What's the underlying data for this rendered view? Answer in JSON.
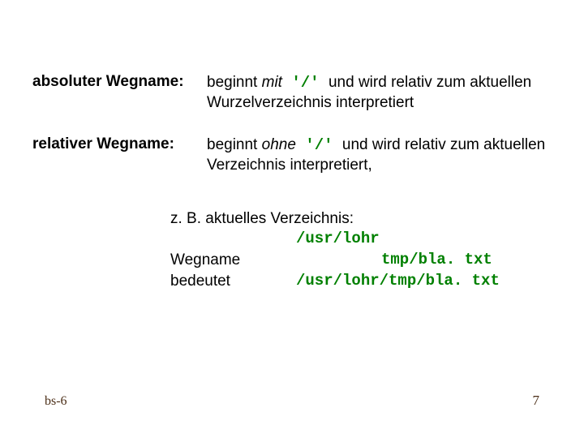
{
  "definitions": {
    "abs": {
      "term": "absoluter Wegname:",
      "pre": "beginnt ",
      "mode": "mit",
      "sep": " '/' ",
      "post": "und wird relativ zum aktuellen Wurzelverzeichnis interpretiert"
    },
    "rel": {
      "term": "relativer Wegname:",
      "pre": "beginnt ",
      "mode": "ohne",
      "sep": " '/' ",
      "post": "und wird relativ zum aktuellen Verzeichnis interpretiert,"
    }
  },
  "example": {
    "lead": "z. B. aktuelles Verzeichnis:",
    "current_dir": "/usr/lohr",
    "label_wegname": "Wegname",
    "path_wegname": "tmp/bla. txt",
    "label_bedeutet": "bedeutet",
    "path_bedeutet": "/usr/lohr/tmp/bla. txt"
  },
  "footer": {
    "left": "bs-6",
    "right": "7"
  }
}
